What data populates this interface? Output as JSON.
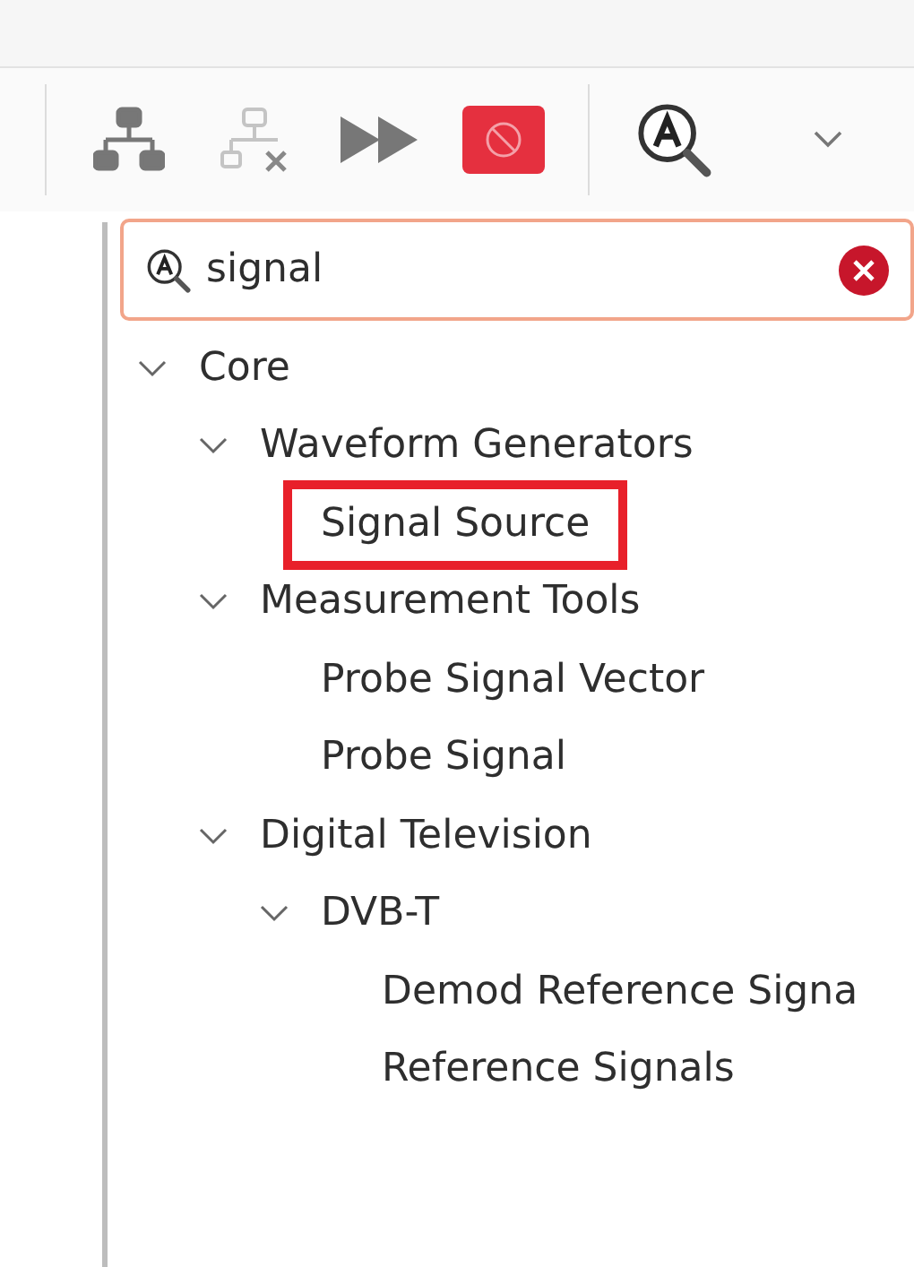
{
  "toolbar": {
    "buttons": [
      {
        "kind": "tree",
        "disabled": false
      },
      {
        "kind": "tree-remove",
        "disabled": true
      },
      {
        "kind": "fast-forward",
        "disabled": false
      },
      {
        "kind": "stop",
        "disabled": false
      },
      {
        "kind": "separator"
      },
      {
        "kind": "search",
        "disabled": false
      },
      {
        "kind": "dropdown",
        "disabled": false
      }
    ]
  },
  "search": {
    "value": "signal"
  },
  "tree": [
    {
      "label": "Core",
      "expanded": true,
      "highlighted": false,
      "children": [
        {
          "label": "Waveform Generators",
          "expanded": true,
          "highlighted": false,
          "children": [
            {
              "label": "Signal Source",
              "highlighted": true
            }
          ]
        },
        {
          "label": "Measurement Tools",
          "expanded": true,
          "highlighted": false,
          "children": [
            {
              "label": "Probe Signal Vector",
              "highlighted": false
            },
            {
              "label": "Probe Signal",
              "highlighted": false
            }
          ]
        },
        {
          "label": "Digital Television",
          "expanded": true,
          "highlighted": false,
          "children": [
            {
              "label": "DVB-T",
              "expanded": true,
              "highlighted": false,
              "children": [
                {
                  "label": "Demod Reference Signa",
                  "highlighted": false
                },
                {
                  "label": "Reference Signals",
                  "highlighted": false
                }
              ]
            }
          ]
        }
      ]
    }
  ]
}
